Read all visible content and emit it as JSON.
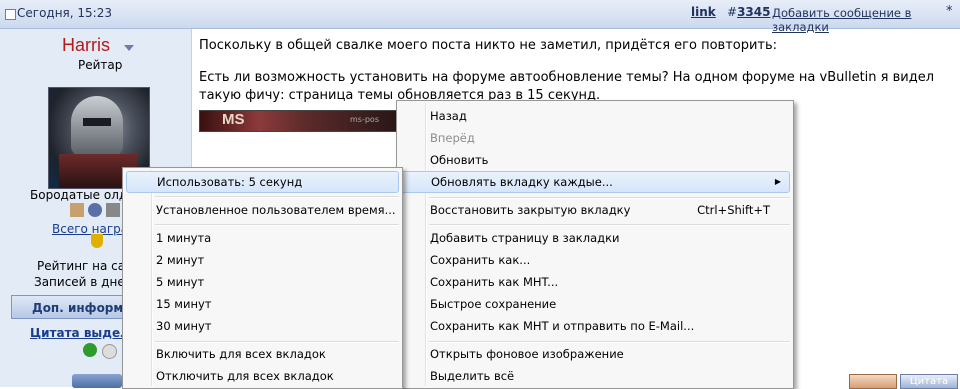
{
  "post_header": {
    "date": "Сегодня, 15:23",
    "link_label": "link",
    "post_prefix": "#",
    "post_number": "3345",
    "bookmark_label": "Добавить сообщение в закладки",
    "star": "*"
  },
  "user": {
    "name": "Harris",
    "rank": "Рейтар",
    "title_partial": "Бородатые олд",
    "awards_link": "Всего наград",
    "rating_partial": "Рейтинг на сай",
    "diary_partial": "Записей в дневн",
    "more_button": "Доп. информа",
    "quote_link": "Цитата выдел"
  },
  "post": {
    "paragraph1": "Поскольку в общей свалке моего поста никто не заметил, придётся его повторить:",
    "paragraph2": "Есть ли возможность установить на форуме автообновление темы? На одном форуме на vBulletin я видел такую фичу: страница темы обновляется раз в 15 секунд.",
    "signature_text": "MS",
    "signature_small": "ms-pos"
  },
  "main_menu": {
    "items": [
      {
        "label": "Назад",
        "disabled": false
      },
      {
        "label": "Вперёд",
        "disabled": true
      },
      {
        "label": "Обновить",
        "disabled": false
      },
      {
        "label": "Обновлять вкладку каждые...",
        "disabled": false,
        "submenu_arrow": "▶"
      },
      {
        "label": "Восстановить закрытую вкладку",
        "shortcut": "Ctrl+Shift+T"
      },
      {
        "label": "Добавить страницу в закладки"
      },
      {
        "label": "Сохранить как..."
      },
      {
        "label": "Сохранить как MHT..."
      },
      {
        "label": "Быстрое сохранение"
      },
      {
        "label": "Сохранить как MHT и отправить по E-Mail..."
      },
      {
        "label": "Открыть фоновое изображение"
      },
      {
        "label": "Выделить всё"
      }
    ]
  },
  "sub_menu": {
    "items": [
      {
        "label": "Использовать: 5 секунд"
      },
      {
        "label": "Установленное пользователем время..."
      },
      {
        "label": "1  минута"
      },
      {
        "label": "2  минут"
      },
      {
        "label": "5  минут"
      },
      {
        "label": "15 минут"
      },
      {
        "label": "30 минут"
      },
      {
        "label": "Включить для всех вкладок"
      },
      {
        "label": "Отключить для всех вкладок"
      }
    ]
  },
  "bottom_buttons": {
    "quote": "Цитата"
  }
}
